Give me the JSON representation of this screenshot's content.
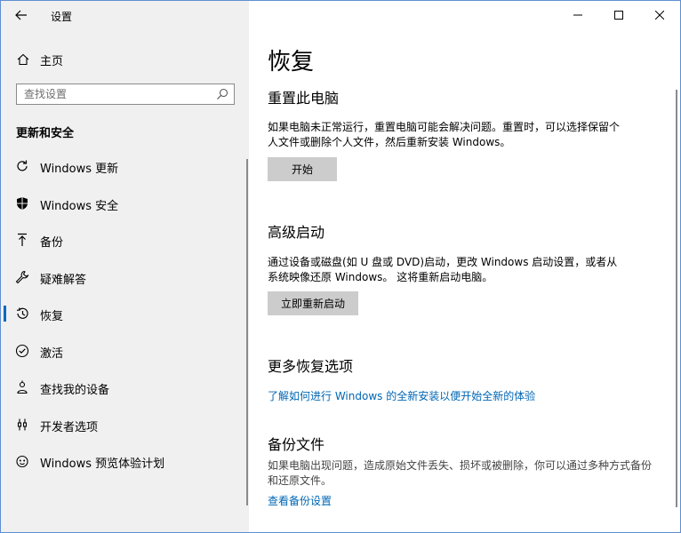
{
  "window": {
    "title": "设置"
  },
  "sidebar": {
    "home_label": "主页",
    "search_placeholder": "查找设置",
    "section_heading": "更新和安全",
    "items": [
      {
        "label": "Windows 更新",
        "icon": "refresh-icon"
      },
      {
        "label": "Windows 安全",
        "icon": "shield-icon"
      },
      {
        "label": "备份",
        "icon": "upload-arrow-icon"
      },
      {
        "label": "疑难解答",
        "icon": "wrench-icon"
      },
      {
        "label": "恢复",
        "icon": "history-icon",
        "active": true
      },
      {
        "label": "激活",
        "icon": "check-circle-icon"
      },
      {
        "label": "查找我的设备",
        "icon": "person-pin-icon"
      },
      {
        "label": "开发者选项",
        "icon": "developer-icon"
      },
      {
        "label": "Windows 预览体验计划",
        "icon": "insider-icon"
      }
    ]
  },
  "main": {
    "page_title": "恢复",
    "reset": {
      "heading": "重置此电脑",
      "description": "如果电脑未正常运行，重置电脑可能会解决问题。重置时，可以选择保留个人文件或删除个人文件，然后重新安装 Windows。",
      "button": "开始"
    },
    "advanced": {
      "heading": "高级启动",
      "description": "通过设备或磁盘(如 U 盘或 DVD)启动，更改 Windows 启动设置，或者从系统映像还原 Windows。 这将重新启动电脑。",
      "button": "立即重新启动"
    },
    "more": {
      "heading": "更多恢复选项",
      "link": "了解如何进行 Windows 的全新安装以便开始全新的体验"
    },
    "backup": {
      "heading": "备份文件",
      "description": "如果电脑出现问题，造成原始文件丢失、损坏或被删除，你可以通过多种方式备份和还原文件。",
      "link": "查看备份设置"
    }
  },
  "colors": {
    "accent": "#0067c0",
    "link": "#0066b4",
    "sidebar_bg": "#f0f0f0",
    "button_bg": "#cccccc"
  }
}
